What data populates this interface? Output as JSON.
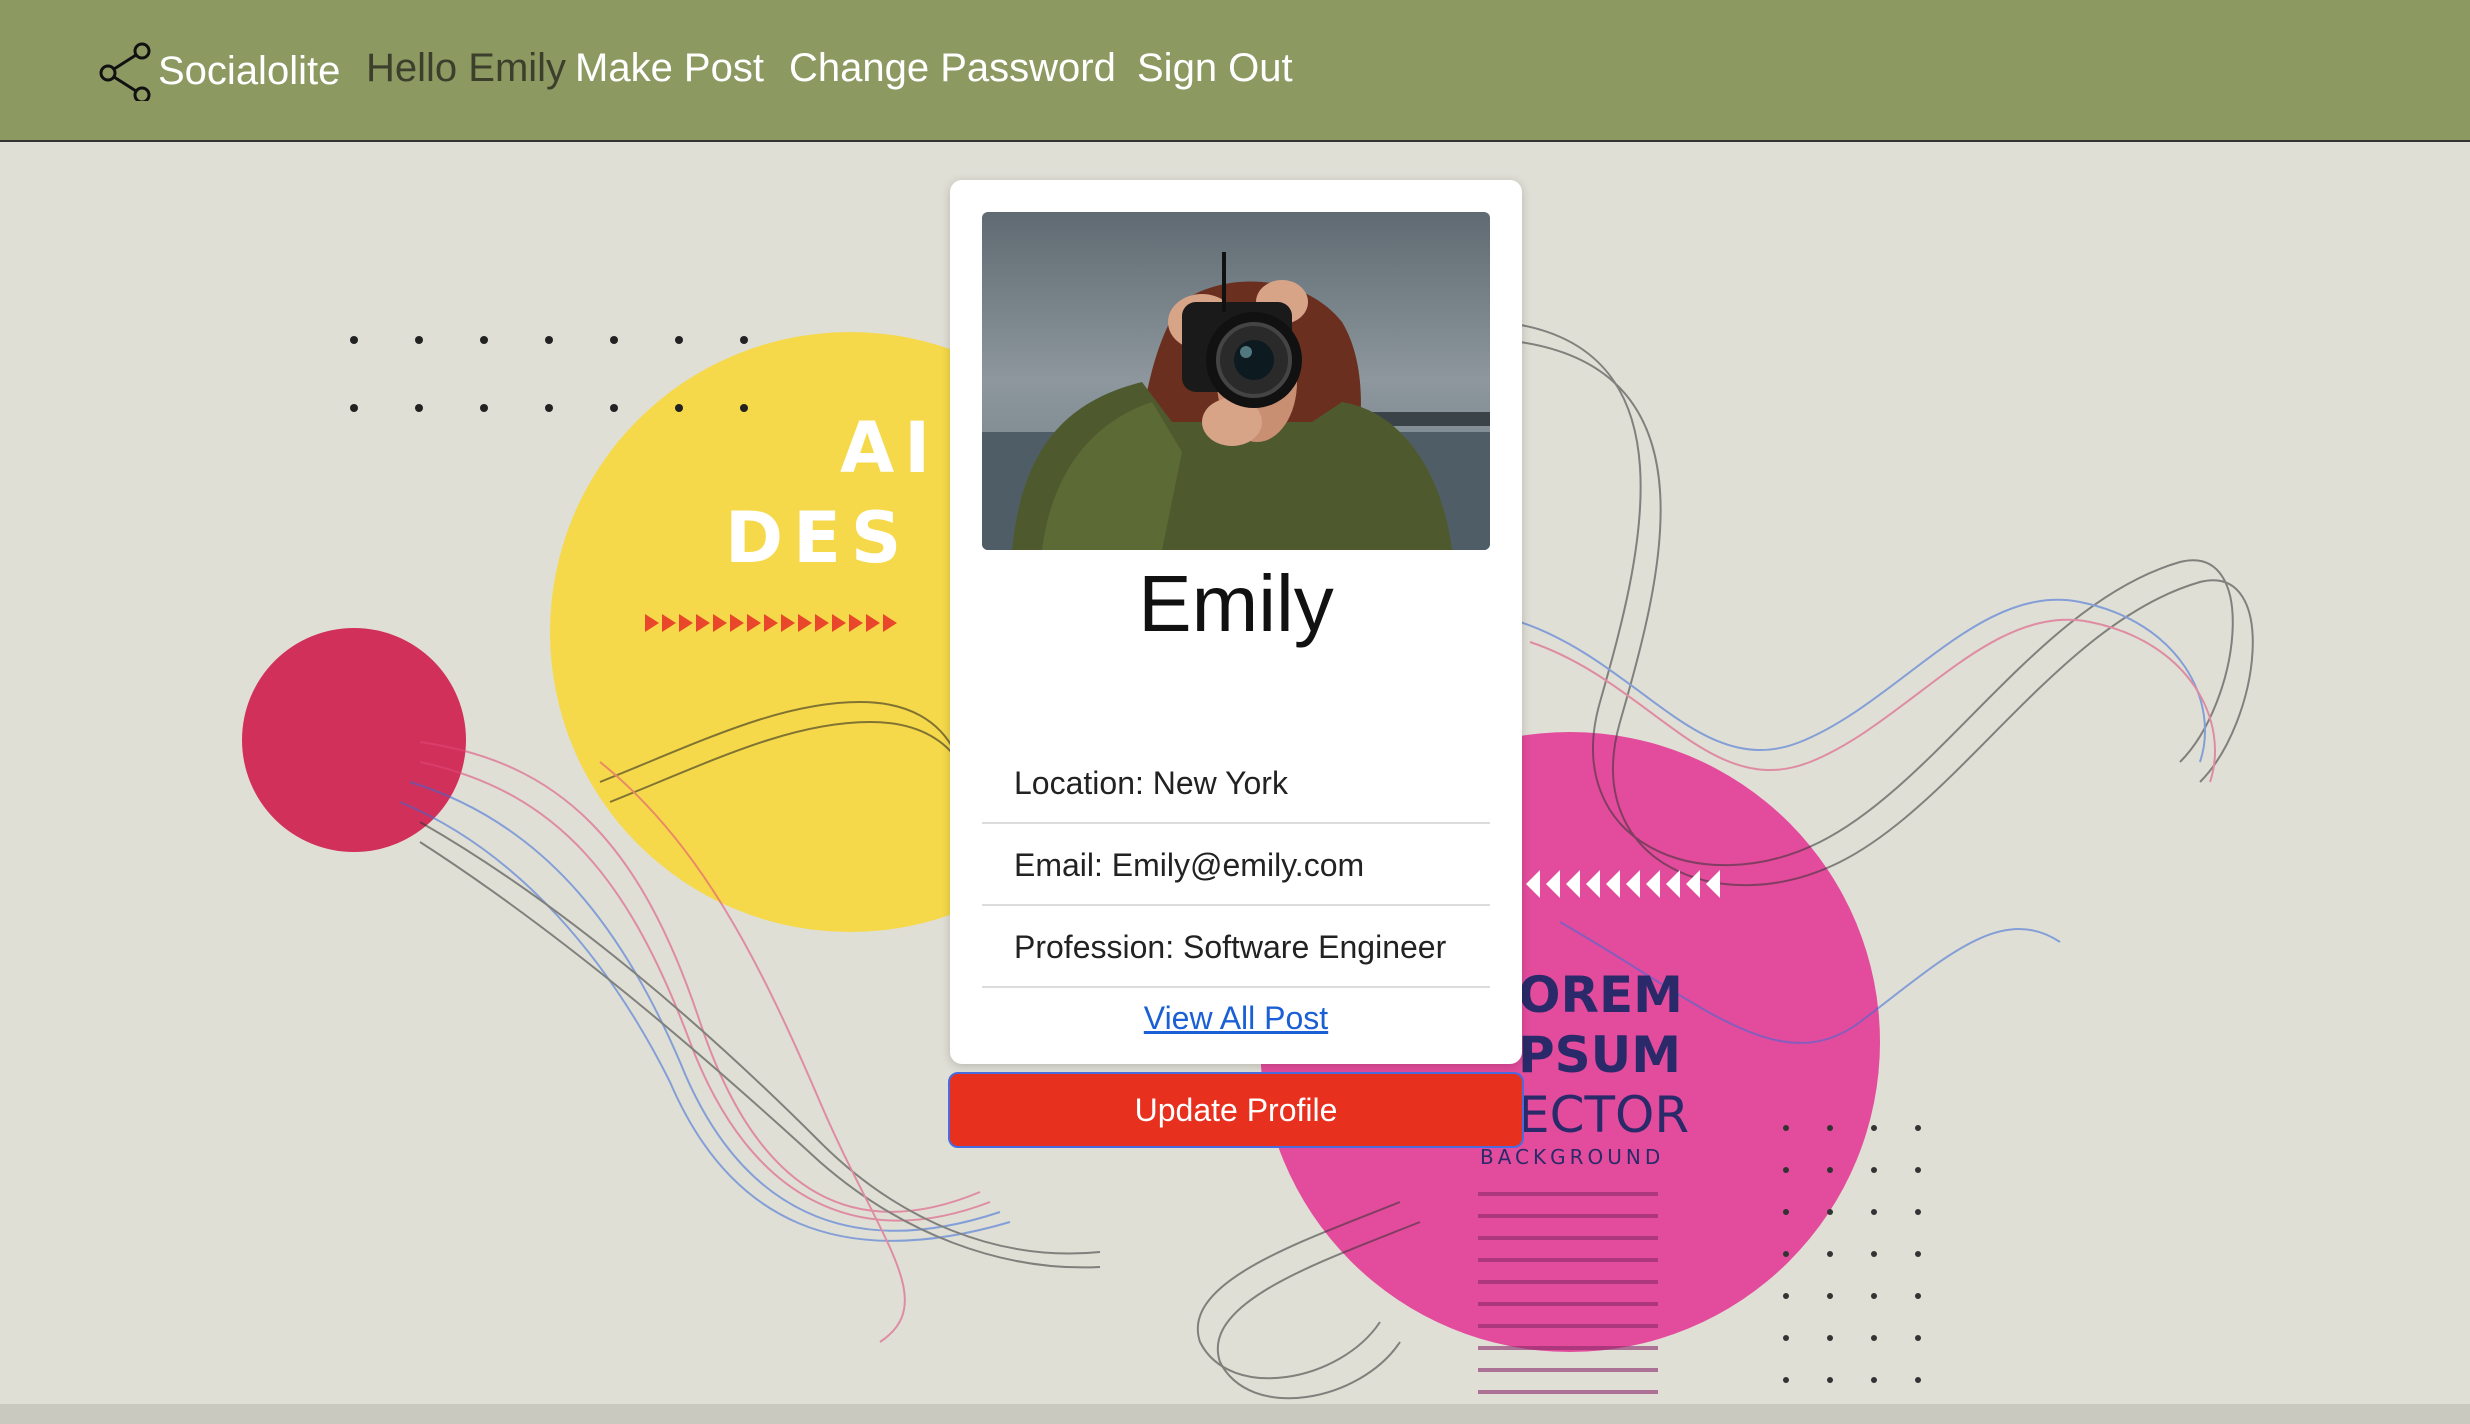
{
  "navbar": {
    "brand_icon": "share-icon",
    "brand": "Socialolite",
    "greeting": "Hello Emily",
    "links": [
      "Make Post",
      "Change Password",
      "Sign Out"
    ],
    "background": "#8c9a62"
  },
  "hero": {
    "headline": [
      "AI",
      "DES"
    ],
    "poster_text": [
      "OREM",
      "PSUM",
      "ECTOR",
      "BACKGROUND"
    ]
  },
  "profile": {
    "photo": "woman-with-camera-photo",
    "name": "Emily",
    "details": [
      "Location: New York",
      "Email: Emily@emily.com",
      "Profession: Software Engineer"
    ],
    "view_all_link": "View All Post",
    "update_button": "Update Profile",
    "button_color": "#e8301f"
  }
}
